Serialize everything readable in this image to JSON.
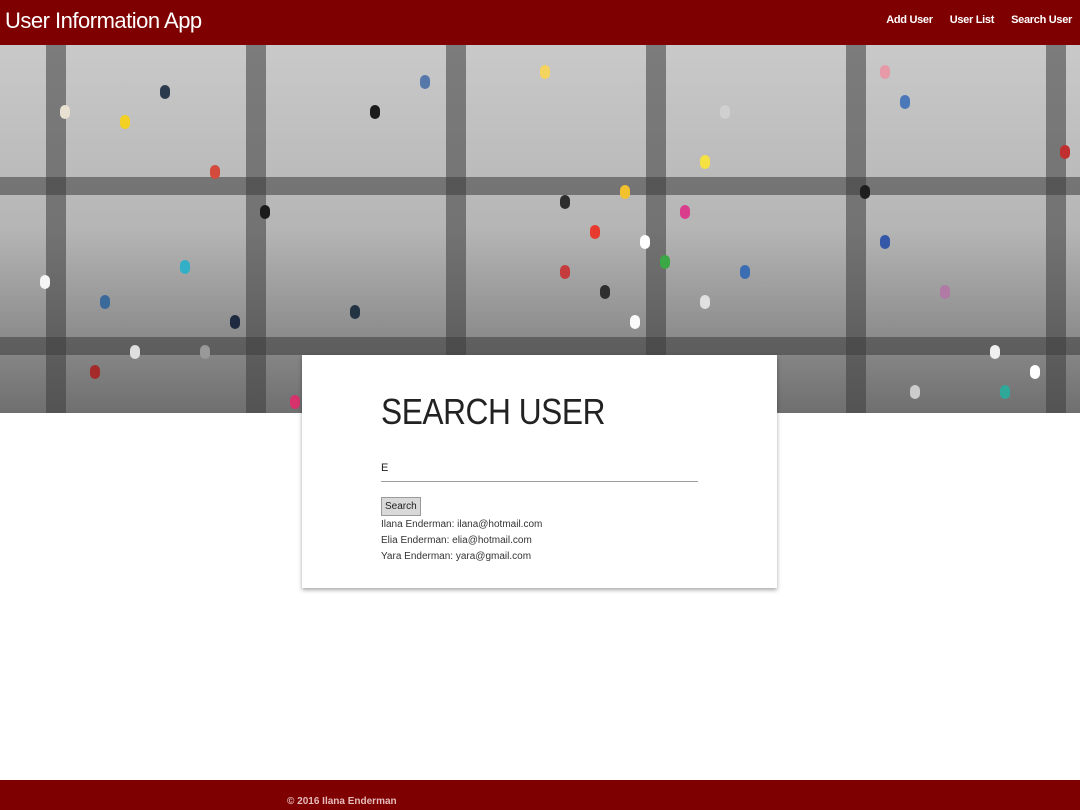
{
  "app": {
    "title": "User Information App"
  },
  "nav": {
    "links": [
      {
        "label": "Add User"
      },
      {
        "label": "User List"
      },
      {
        "label": "Search User"
      }
    ]
  },
  "card": {
    "title": "SEARCH USER",
    "search_value": "E",
    "button_label": "Search",
    "results": [
      "Ilana Enderman: ilana@hotmail.com",
      "Elia Enderman: elia@hotmail.com",
      "Yara Enderman: yara@gmail.com"
    ]
  },
  "footer": {
    "copyright": "© 2016 Ilana Enderman"
  },
  "colors": {
    "brand": "#7e0000"
  }
}
